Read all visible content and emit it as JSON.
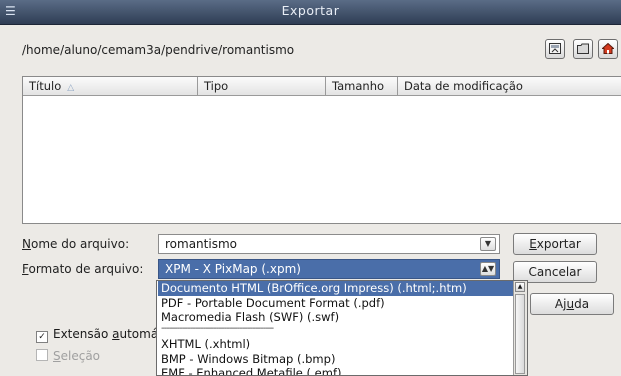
{
  "window": {
    "title": "Exportar"
  },
  "path": "/home/aluno/cemam3a/pendrive/romantismo",
  "toolbar": {
    "icons": [
      "up-folder-icon",
      "new-folder-icon",
      "home-icon"
    ]
  },
  "file_list": {
    "columns": [
      "Título",
      "Tipo",
      "Tamanho",
      "Data de modificação"
    ],
    "sort_indicator": "△"
  },
  "filename": {
    "label_prefix": "N",
    "label_rest": "ome do arquivo:",
    "value": "romantismo"
  },
  "format": {
    "label_prefix": "F",
    "label_rest": "ormato de arquivo:",
    "selected": "XPM - X PixMap (.xpm)"
  },
  "buttons": {
    "export_prefix": "E",
    "export_rest": "xportar",
    "cancel": "Cancelar",
    "help_a": "Aj",
    "help_u": "u",
    "help_b": "da"
  },
  "checks": {
    "auto_ext_a": "Extensão ",
    "auto_ext_u": "a",
    "auto_ext_b": "utomát",
    "selection_u": "S",
    "selection_rest": "eleção"
  },
  "dropdown_options": [
    "Documento HTML (BrOffice.org Impress) (.html;.htm)",
    "PDF - Portable Document Format (.pdf)",
    "Macromedia Flash (SWF) (.swf)",
    "-------------------------------------------",
    "XHTML (.xhtml)",
    "BMP - Windows Bitmap (.bmp)",
    "EMF - Enhanced Metafile (.emf)"
  ],
  "colors": {
    "selection": "#4a6ea9",
    "titlebar": "#3f4f6a",
    "dialog_bg": "#eceae6"
  }
}
